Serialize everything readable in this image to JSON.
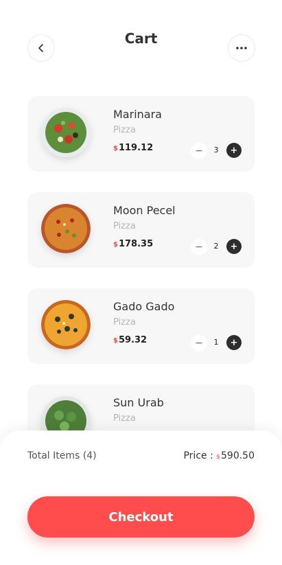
{
  "header": {
    "title": "Cart"
  },
  "items": [
    {
      "name": "Marinara",
      "category": "Pizza",
      "currency": "$",
      "price": "119.12",
      "qty": "3",
      "image": "salad-bowl"
    },
    {
      "name": "Moon Pecel",
      "category": "Pizza",
      "currency": "$",
      "price": "178.35",
      "qty": "2",
      "image": "pizza"
    },
    {
      "name": "Gado Gado",
      "category": "Pizza",
      "currency": "$",
      "price": "59.32",
      "qty": "1",
      "image": "pizza"
    },
    {
      "name": "Sun Urab",
      "category": "Pizza",
      "image": "greens-bowl"
    }
  ],
  "summary": {
    "total_items_label": "Total Items (4)",
    "price_label": "Price :",
    "currency": "$",
    "total_price": "590.50"
  },
  "checkout_label": "Checkout",
  "colors": {
    "accent": "#ff4d4d",
    "dark": "#2d2d2d",
    "card": "#f7f7f7"
  }
}
